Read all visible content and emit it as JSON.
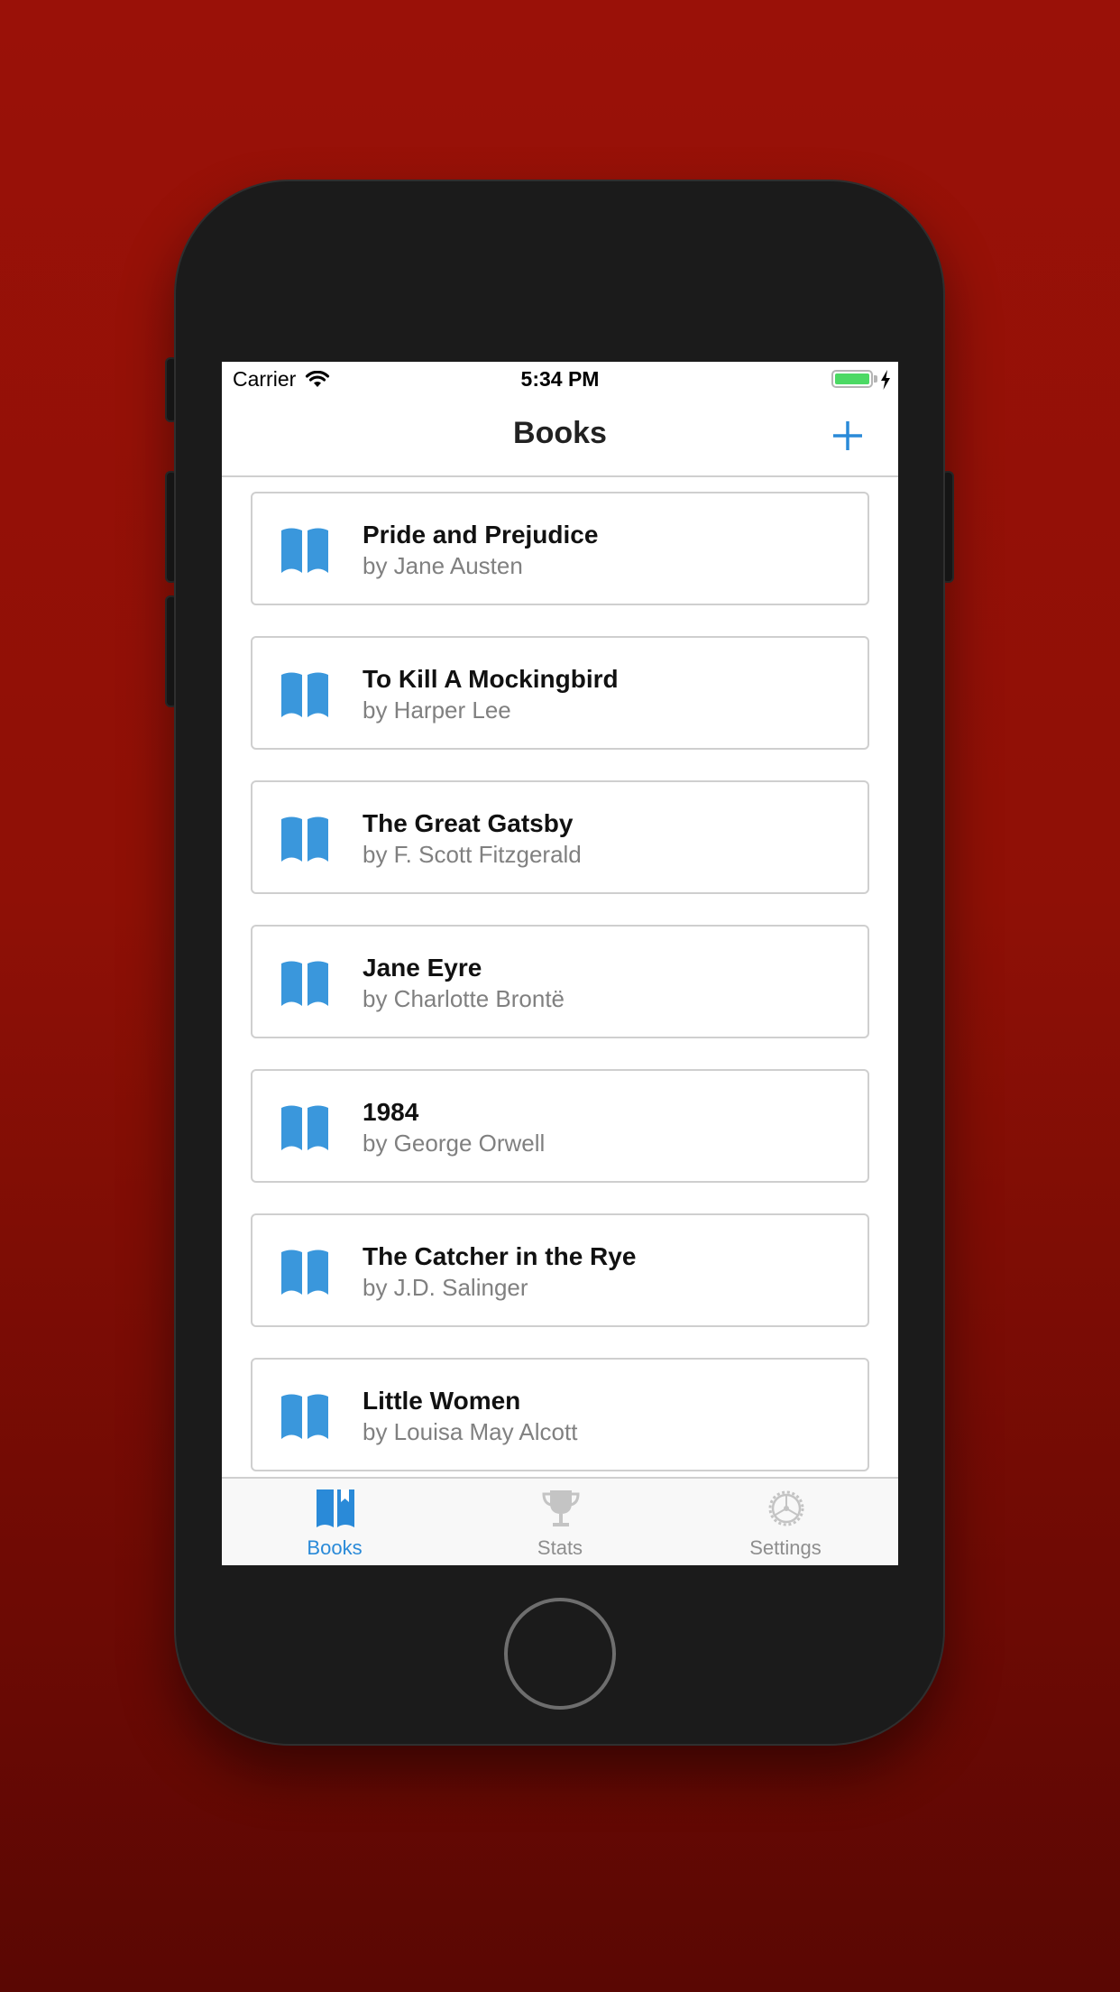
{
  "status_bar": {
    "carrier": "Carrier",
    "time": "5:34 PM",
    "battery_level": 1.0,
    "charging": true
  },
  "nav": {
    "title": "Books",
    "add_icon": "plus-icon"
  },
  "books": [
    {
      "title": "Pride and Prejudice",
      "author": "by Jane Austen",
      "icon": "open-book-icon"
    },
    {
      "title": "To Kill A Mockingbird",
      "author": "by Harper Lee",
      "icon": "open-book-icon"
    },
    {
      "title": "The Great Gatsby",
      "author": "by F. Scott Fitzgerald",
      "icon": "open-book-icon"
    },
    {
      "title": "Jane Eyre",
      "author": "by Charlotte Brontë",
      "icon": "open-book-icon"
    },
    {
      "title": "1984",
      "author": "by George Orwell",
      "icon": "open-book-icon"
    },
    {
      "title": "The Catcher in the Rye",
      "author": "by J.D. Salinger",
      "icon": "open-book-icon"
    },
    {
      "title": "Little Women",
      "author": "by Louisa May Alcott",
      "icon": "open-book-icon"
    }
  ],
  "tabs": [
    {
      "label": "Books",
      "icon": "bookmark-book-icon",
      "active": true
    },
    {
      "label": "Stats",
      "icon": "trophy-icon",
      "active": false
    },
    {
      "label": "Settings",
      "icon": "gear-icon",
      "active": false
    }
  ],
  "colors": {
    "accent": "#2a8ad8",
    "icon_blue": "#3a97dc",
    "inactive": "#8e8e8e",
    "background": "#9a1108",
    "battery": "#4cd964"
  }
}
